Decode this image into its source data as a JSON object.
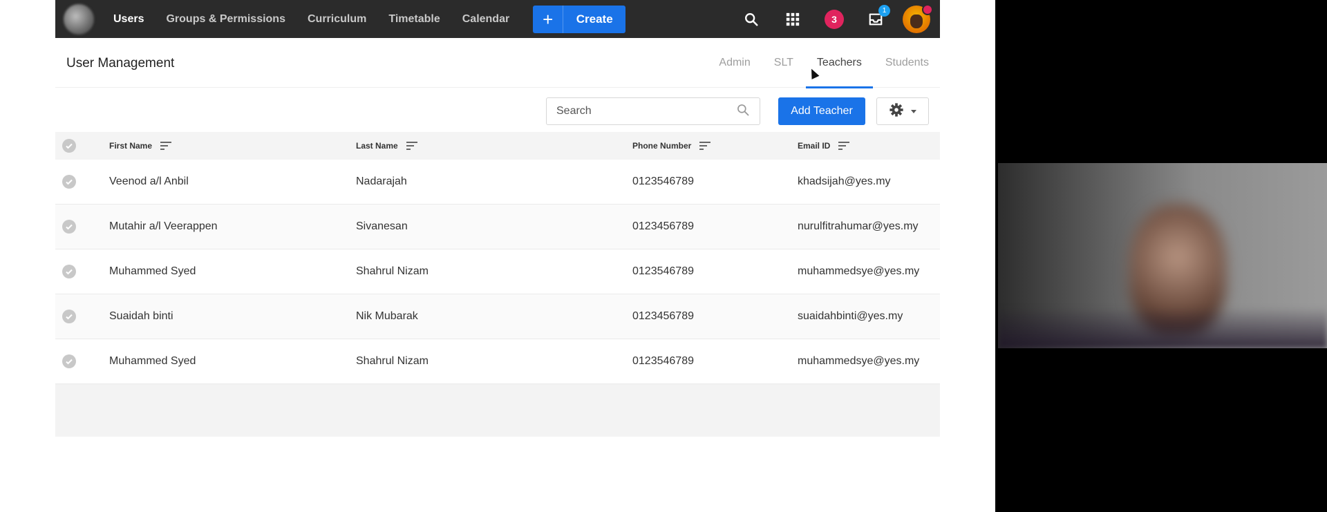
{
  "nav": {
    "links": [
      "Users",
      "Groups & Permissions",
      "Curriculum",
      "Timetable",
      "Calendar"
    ],
    "create_label": "Create",
    "notification_count": "3",
    "inbox_count": "1"
  },
  "page": {
    "title": "User Management",
    "tabs": [
      "Admin",
      "SLT",
      "Teachers",
      "Students"
    ],
    "active_tab": "Teachers"
  },
  "toolbar": {
    "search_placeholder": "Search",
    "add_label": "Add Teacher"
  },
  "table": {
    "headers": [
      "First Name",
      "Last Name",
      "Phone Number",
      "Email ID"
    ],
    "rows": [
      [
        "Veenod a/l Anbil",
        "Nadarajah",
        "0123546789",
        "khadsijah@yes.my"
      ],
      [
        "Mutahir a/l Veerappen",
        "Sivanesan",
        "0123456789",
        "nurulfitrahumar@yes.my"
      ],
      [
        "Muhammed Syed",
        "Shahrul Nizam",
        "0123546789",
        "muhammedsye@yes.my"
      ],
      [
        "Suaidah binti",
        "Nik Mubarak",
        "0123456789",
        "suaidahbinti@yes.my"
      ],
      [
        "Muhammed Syed",
        "Shahrul Nizam",
        "0123546789",
        "muhammedsye@yes.my"
      ]
    ]
  }
}
